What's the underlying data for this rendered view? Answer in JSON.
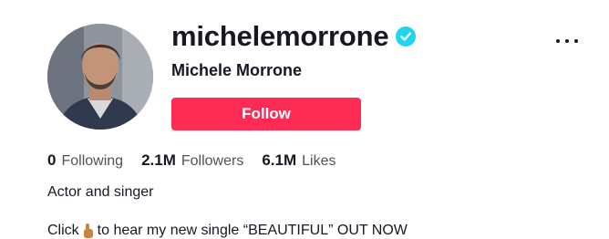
{
  "profile": {
    "username": "michelemorrone",
    "display_name": "Michele Morrone",
    "follow_label": "Follow",
    "verified_icon": "verified-check-icon",
    "more_icon": "more-options-icon",
    "colors": {
      "follow_bg": "#fe2c55",
      "verified": "#20d5ec",
      "text": "#161823",
      "secondary_text": "#51525a"
    }
  },
  "stats": [
    {
      "value": "0",
      "label": "Following"
    },
    {
      "value": "2.1M",
      "label": "Followers"
    },
    {
      "value": "6.1M",
      "label": "Likes"
    }
  ],
  "bio": {
    "line1": "Actor and singer",
    "line2_before": "Click",
    "line2_emoji_icon": "pointing-hand-emoji-icon",
    "line2_after": "to hear my new single “BEAUTIFUL” OUT NOW"
  }
}
